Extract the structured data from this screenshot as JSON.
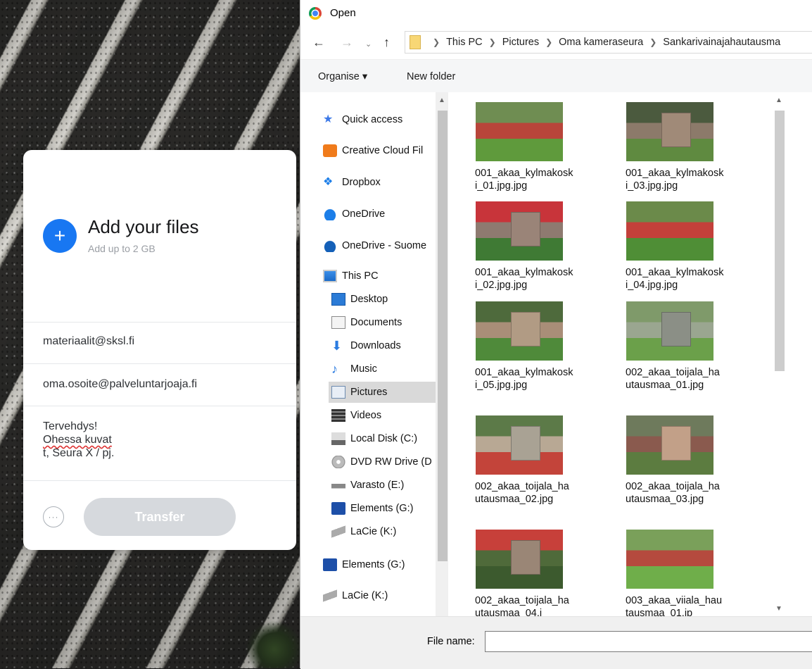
{
  "transfer_card": {
    "add_title": "Add your files",
    "add_subtitle": "Add up to 2 GB",
    "email_to": "materiaalit@sksl.fi",
    "email_from": "oma.osoite@palveluntarjoaja.fi",
    "message_lines": [
      "Tervehdys!",
      "Ohessa kuvat",
      "t, Seura X / pj."
    ],
    "transfer_label": "Transfer",
    "more_label": "···",
    "accent": "#1877f2"
  },
  "dialog": {
    "title": "Open",
    "breadcrumb": [
      "This PC",
      "Pictures",
      "Oma kameraseura",
      "Sankarivainajahautausma"
    ],
    "organise_label": "Organise ▾",
    "new_folder_label": "New folder",
    "nav_items": [
      {
        "label": "Quick access",
        "icon": "star-icon"
      },
      {
        "label": "Creative Cloud Fil",
        "icon": "creative-cloud-icon"
      },
      {
        "label": "Dropbox",
        "icon": "dropbox-icon"
      },
      {
        "label": "OneDrive",
        "icon": "onedrive-icon"
      },
      {
        "label": "OneDrive - Suome",
        "icon": "onedrive-business-icon"
      },
      {
        "label": "This PC",
        "icon": "computer-icon"
      },
      {
        "label": "Desktop",
        "icon": "desktop-icon"
      },
      {
        "label": "Documents",
        "icon": "documents-icon"
      },
      {
        "label": "Downloads",
        "icon": "downloads-icon"
      },
      {
        "label": "Music",
        "icon": "music-icon"
      },
      {
        "label": "Pictures",
        "icon": "pictures-icon"
      },
      {
        "label": "Videos",
        "icon": "videos-icon"
      },
      {
        "label": "Local Disk (C:)",
        "icon": "local-disk-icon"
      },
      {
        "label": "DVD RW Drive (D",
        "icon": "dvd-drive-icon"
      },
      {
        "label": "Varasto (E:)",
        "icon": "drive-icon"
      },
      {
        "label": "Elements (G:)",
        "icon": "wd-drive-icon"
      },
      {
        "label": "LaCie (K:)",
        "icon": "lacie-drive-icon"
      },
      {
        "label": "Elements (G:)",
        "icon": "wd-drive-icon"
      },
      {
        "label": "LaCie (K:)",
        "icon": "lacie-drive-icon"
      }
    ],
    "files": [
      {
        "name": "001_akaa_kylmakoski_01.jpg.jpg"
      },
      {
        "name": "001_akaa_kylmakoski_03.jpg.jpg"
      },
      {
        "name": "001_akaa_kylmakoski_02.jpg.jpg"
      },
      {
        "name": "001_akaa_kylmakoski_04.jpg.jpg"
      },
      {
        "name": "001_akaa_kylmakoski_05.jpg.jpg"
      },
      {
        "name": "002_akaa_toijala_hautausmaa_01.jpg"
      },
      {
        "name": "002_akaa_toijala_hautausmaa_02.jpg"
      },
      {
        "name": "002_akaa_toijala_hautausmaa_03.jpg"
      },
      {
        "name": "002_akaa_toijala_hautausmaa_04.j"
      },
      {
        "name": "003_akaa_viiala_hautausmaa_01.jp"
      }
    ],
    "file_name_label": "File name:",
    "file_name_value": ""
  }
}
